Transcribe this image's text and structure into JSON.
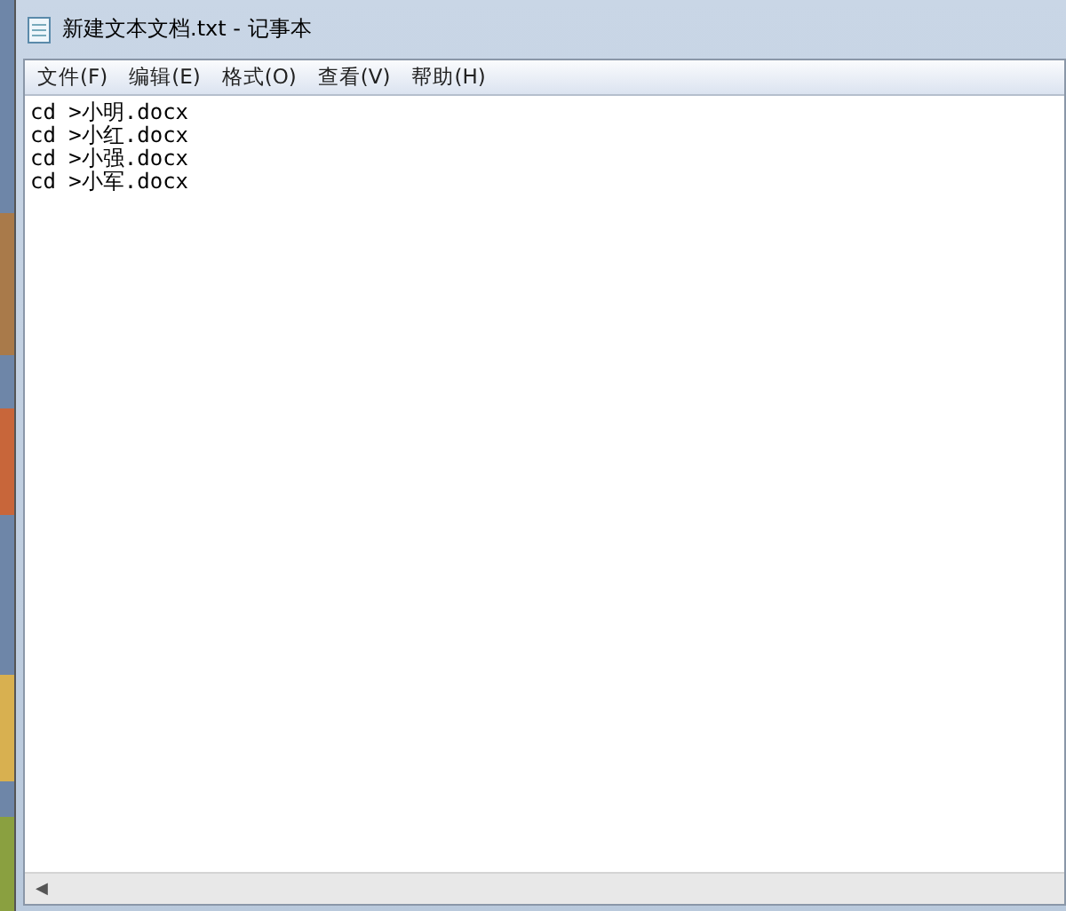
{
  "window": {
    "title": "新建文本文档.txt - 记事本"
  },
  "menu": [
    {
      "label": "文件(F)"
    },
    {
      "label": "编辑(E)"
    },
    {
      "label": "格式(O)"
    },
    {
      "label": "查看(V)"
    },
    {
      "label": "帮助(H)"
    }
  ],
  "editor": {
    "lines": [
      "cd >小明.docx",
      "cd >小红.docx",
      "cd >小强.docx",
      "cd >小军.docx"
    ]
  },
  "scrollbar": {
    "left_arrow": "◀"
  }
}
